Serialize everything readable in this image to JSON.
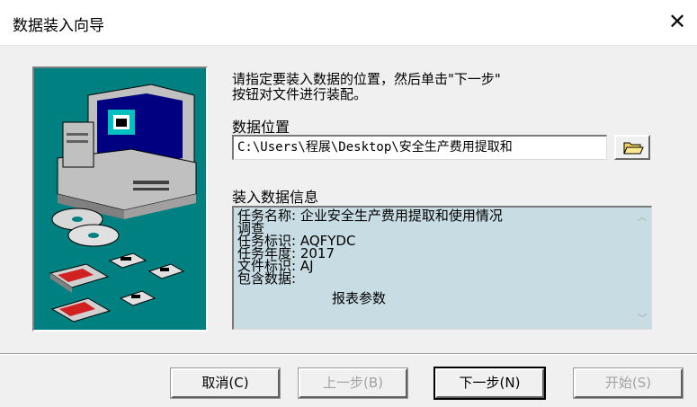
{
  "window": {
    "title": "数据装入向导",
    "close_glyph": "✕"
  },
  "instructions": {
    "line1": "请指定要装入数据的位置，然后单击\"下一步\"",
    "line2": "按钮对文件进行装配。"
  },
  "location": {
    "label": "数据位置",
    "path": "C:\\Users\\程展\\Desktop\\安全生产费用提取和",
    "browse_icon": "open-folder-icon"
  },
  "info": {
    "label": "装入数据信息",
    "lines": [
      "任务名称: 企业安全生产费用提取和使用情况",
      "调查",
      "任务标识: AQFYDC",
      "任务年度: 2017",
      "文件标识: AJ",
      "包含数据:"
    ],
    "included": "报表参数",
    "scroll_up": "︿",
    "scroll_down": "﹀"
  },
  "buttons": {
    "cancel": "取消(C)",
    "back": "上一步(B)",
    "next": "下一步(N)",
    "start": "开始(S)"
  },
  "colors": {
    "illustration_bg": "#008080",
    "info_bg": "#c8dce3",
    "dialog_bg": "#f0f0f0"
  }
}
